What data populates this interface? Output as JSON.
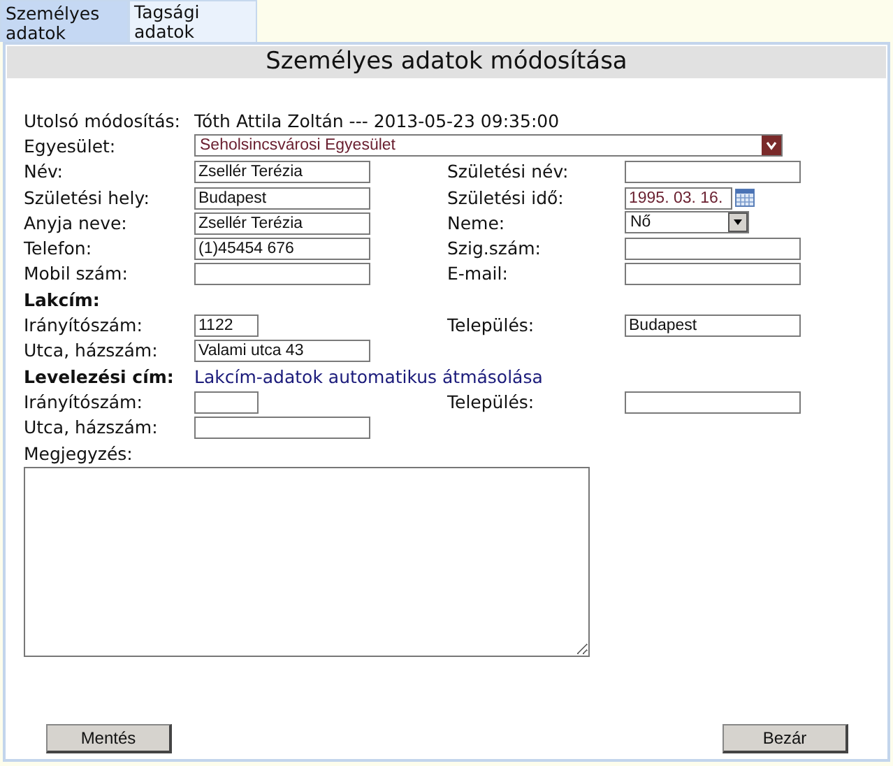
{
  "tabs": [
    {
      "label": "Személyes adatok",
      "selected": true
    },
    {
      "label": "Tagsági adatok",
      "selected": false
    }
  ],
  "title": "Személyes adatok módosítása",
  "last_modified": {
    "label": "Utolsó módosítás:",
    "value": "Tóth Attila Zoltán --- 2013-05-23 09:35:00"
  },
  "association": {
    "label": "Egyesület:",
    "value": "Seholsincsvárosi Egyesület"
  },
  "rows": [
    {
      "kind": "fields",
      "left": {
        "label": "Név:",
        "kind": "text",
        "value": "Zsellér Terézia"
      },
      "right": {
        "label": "Születési név:",
        "kind": "text"
      }
    },
    {
      "kind": "fields",
      "left": {
        "label": "Születési hely:",
        "kind": "text",
        "value": "Budapest"
      },
      "right": {
        "label": "Születési idő:",
        "kind": "date",
        "value": "1995. 03. 16."
      }
    },
    {
      "kind": "fields",
      "left": {
        "label": "Anyja neve:",
        "kind": "text",
        "value": "Zsellér Terézia"
      },
      "right": {
        "label": "Neme:",
        "kind": "select",
        "value": "Nő"
      }
    },
    {
      "kind": "fields",
      "left": {
        "label": "Telefon:",
        "kind": "text",
        "value": "(1)45454 676"
      },
      "right": {
        "label": "Szig.szám:",
        "kind": "text"
      }
    },
    {
      "kind": "fields",
      "left": {
        "label": "Mobil szám:",
        "kind": "text"
      },
      "right": {
        "label": "E-mail:",
        "kind": "text"
      }
    },
    {
      "kind": "heading",
      "label": "Lakcím:"
    },
    {
      "kind": "fields",
      "left": {
        "label": "Irányítószám:",
        "kind": "short",
        "value": "1122"
      },
      "right": {
        "label": "Település:",
        "kind": "text",
        "value": "Budapest"
      }
    },
    {
      "kind": "fields",
      "left": {
        "label": "Utca, házszám:",
        "kind": "text",
        "value": "Valami utca 43"
      }
    },
    {
      "kind": "heading",
      "label": "Levelezési cím:",
      "link": "Lakcím-adatok automatikus átmásolása"
    },
    {
      "kind": "fields",
      "left": {
        "label": "Irányítószám:",
        "kind": "short"
      },
      "right": {
        "label": "Település:",
        "kind": "text"
      }
    },
    {
      "kind": "fields",
      "left": {
        "label": "Utca, házszám:",
        "kind": "text"
      }
    }
  ],
  "notes": {
    "label": "Megjegyzés:"
  },
  "buttons": [
    "Mentés",
    "Bezár"
  ]
}
